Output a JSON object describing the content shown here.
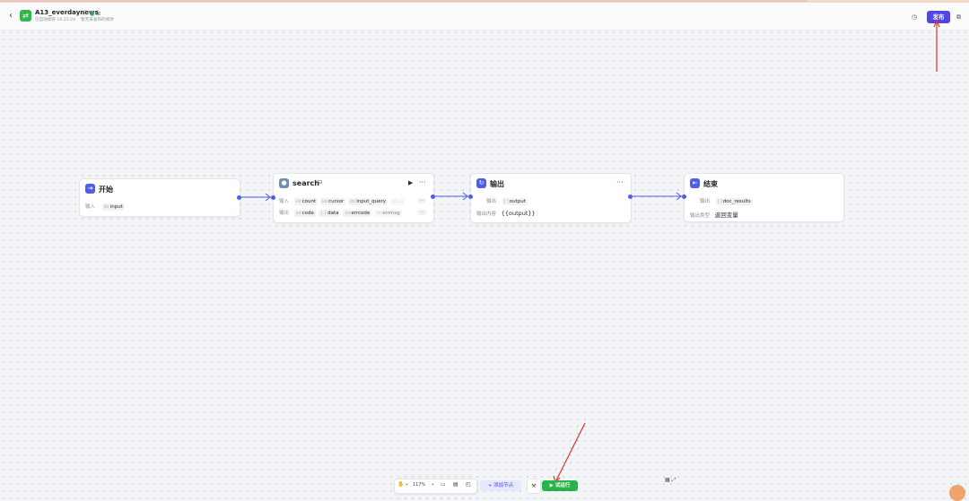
{
  "header": {
    "back_icon": "‹",
    "app_icon": "workflow-icon",
    "app_name": "A13_everdaynews",
    "status_icons": "ⓘ",
    "ok_mark": "●",
    "extra_icon": "⊞",
    "autosave": "已自动保存 16:21:24",
    "published_state": "暂无未发布的修改",
    "history_icon": "◷",
    "publish": "发布",
    "copy_icon": "⧉"
  },
  "nodes": {
    "start": {
      "title": "开始",
      "input_label": "输入",
      "input_type": "str",
      "input_name": "input"
    },
    "search": {
      "title": "search",
      "badge": "⊟",
      "run_icon": "▶",
      "more": "···",
      "input_label": "输入",
      "inputs": [
        {
          "type": "int",
          "name": "count"
        },
        {
          "type": "int",
          "name": "cursor"
        },
        {
          "type": "str",
          "name": "input_query"
        },
        {
          "type": "str",
          "name": "..."
        }
      ],
      "output_label": "输出",
      "outputs": [
        {
          "type": "int",
          "name": "code"
        },
        {
          "type": "{ }",
          "name": "data"
        },
        {
          "type": "int",
          "name": "errcode"
        },
        {
          "type": "str",
          "name": "errmsg"
        }
      ],
      "overflow": "···"
    },
    "output": {
      "title": "输出",
      "more": "···",
      "output_label": "输出",
      "output_type": "[ ]",
      "output_name": "output",
      "content_label": "输出内容",
      "content_value": "{{output}}"
    },
    "end": {
      "title": "结束",
      "output_label": "输出",
      "output_type": "[ ]",
      "output_name": "doc_results",
      "mode_label": "输出类型",
      "mode_value": "返回变量"
    }
  },
  "toolbar": {
    "hand_icon": "✋",
    "caret": "⌄",
    "zoom": "117%",
    "comment_icon": "▭",
    "layout_icon": "▤",
    "minimap_icon": "◰",
    "add_node": "+ 添加节点",
    "wrench_icon": "⚒",
    "trial_run": "▶ 试运行",
    "qr_icon": "▦",
    "expand_icon": "⤢"
  },
  "colors": {
    "accent": "#4f46e5",
    "edge": "#4f5dea",
    "run_green": "#2bb24c",
    "annotation_red": "#e0312b"
  }
}
